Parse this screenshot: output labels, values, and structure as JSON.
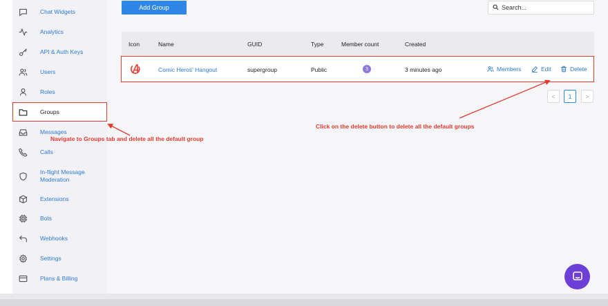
{
  "sidebar": {
    "items": [
      {
        "label": "Chat Widgets",
        "icon": "chat-icon"
      },
      {
        "label": "Analytics",
        "icon": "activity-icon"
      },
      {
        "label": "API & Auth Keys",
        "icon": "key-icon"
      },
      {
        "label": "Users",
        "icon": "users-icon"
      },
      {
        "label": "Roles",
        "icon": "user-icon"
      },
      {
        "label": "Groups",
        "icon": "folder-icon",
        "active": true
      },
      {
        "label": "Messages",
        "icon": "inbox-icon"
      },
      {
        "label": "Calls",
        "icon": "phone-icon"
      },
      {
        "label": "In-flight Message Moderation",
        "icon": "shield-icon"
      },
      {
        "label": "Extensions",
        "icon": "box-icon"
      },
      {
        "label": "Bots",
        "icon": "cpu-icon"
      },
      {
        "label": "Webhooks",
        "icon": "return-arrow-icon"
      },
      {
        "label": "Settings",
        "icon": "gear-icon"
      },
      {
        "label": "Plans & Billing",
        "icon": "credit-card-icon"
      }
    ]
  },
  "toolbar": {
    "add_group_label": "Add Group",
    "search_placeholder": "Search..."
  },
  "table": {
    "headers": {
      "icon": "Icon",
      "name": "Name",
      "guid": "GUID",
      "type": "Type",
      "member_count": "Member count",
      "created": "Created"
    },
    "rows": [
      {
        "icon": "avengers-logo-icon",
        "name": "Comic Heros' Hangout",
        "guid": "supergroup",
        "type": "Public",
        "member_count": "3",
        "created": "3 minutes ago",
        "actions": {
          "members": "Members",
          "edit": "Edit",
          "delete": "Delete"
        }
      }
    ]
  },
  "pagination": {
    "prev": "<",
    "current": "1",
    "next": ">"
  },
  "annotations": {
    "groups_note": "Navigate to Groups tab and delete all the default group",
    "delete_note": "Click on the delete button to delete all the default groups"
  },
  "colors": {
    "accent": "#2e86e6",
    "annotation": "#e53a2f",
    "badge": "#8c78d8",
    "fab": "#6c3fd7"
  }
}
